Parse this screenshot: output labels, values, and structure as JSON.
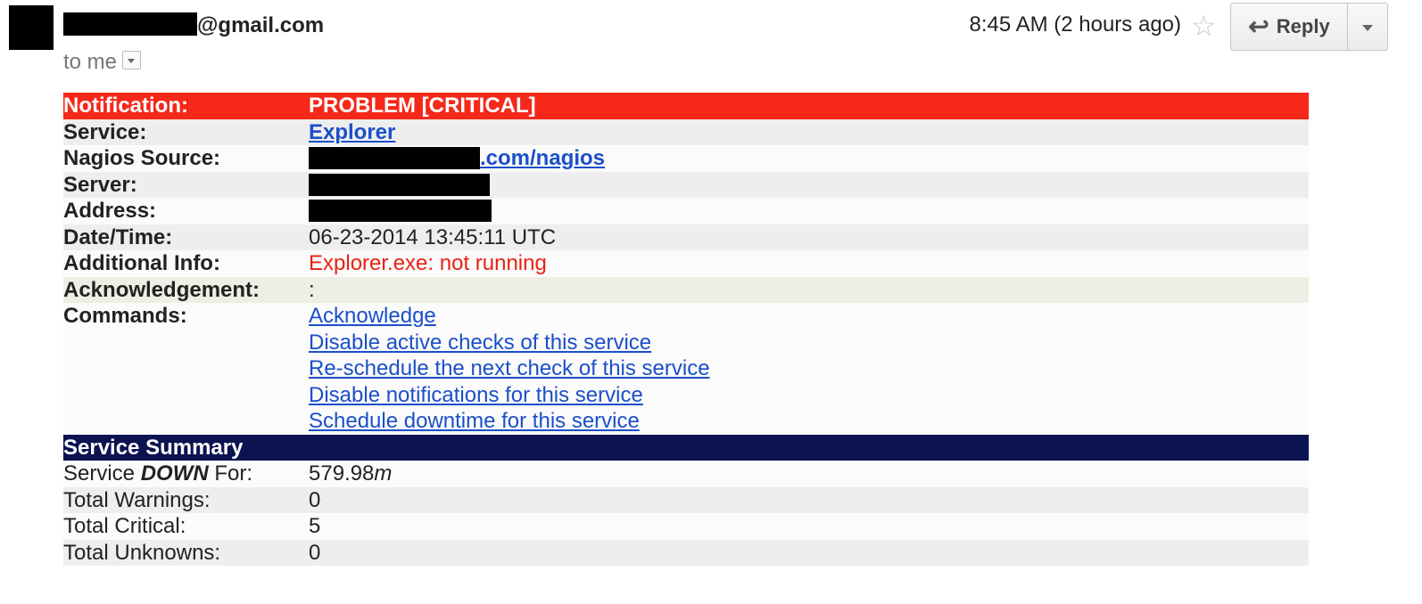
{
  "header": {
    "sender_suffix": "@gmail.com",
    "to_label": "to me",
    "time": "8:45 AM (2 hours ago)",
    "reply_label": "Reply"
  },
  "notification": {
    "notification_label": "Notification:",
    "notification_value": "PROBLEM [CRITICAL]",
    "service_label": "Service:",
    "service_value": "Explorer",
    "source_label": "Nagios Source:",
    "source_suffix": ".com/nagios",
    "server_label": "Server:",
    "address_label": "Address:",
    "datetime_label": "Date/Time:",
    "datetime_value": "06-23-2014 13:45:11 UTC",
    "info_label": "Additional Info:",
    "info_value": "Explorer.exe: not running",
    "ack_label": "Acknowledgement:",
    "ack_value": ":",
    "commands_label": "Commands:",
    "commands": [
      "Acknowledge",
      "Disable active checks of this service",
      "Re-schedule the next check of this service",
      "Disable notifications for this service",
      "Schedule downtime for this service"
    ]
  },
  "summary": {
    "title": "Service Summary",
    "down_prefix": "Service ",
    "down_word": "DOWN",
    "down_suffix": " For:",
    "down_value_num": "579.98",
    "down_value_unit": "m",
    "warnings_label": "Total Warnings:",
    "warnings_value": "0",
    "critical_label": "Total Critical:",
    "critical_value": "5",
    "unknowns_label": "Total Unknowns:",
    "unknowns_value": "0"
  },
  "colors": {
    "problem_red": "#f5281a",
    "summary_navy": "#0b1450",
    "link_blue": "#1b4fc9"
  }
}
